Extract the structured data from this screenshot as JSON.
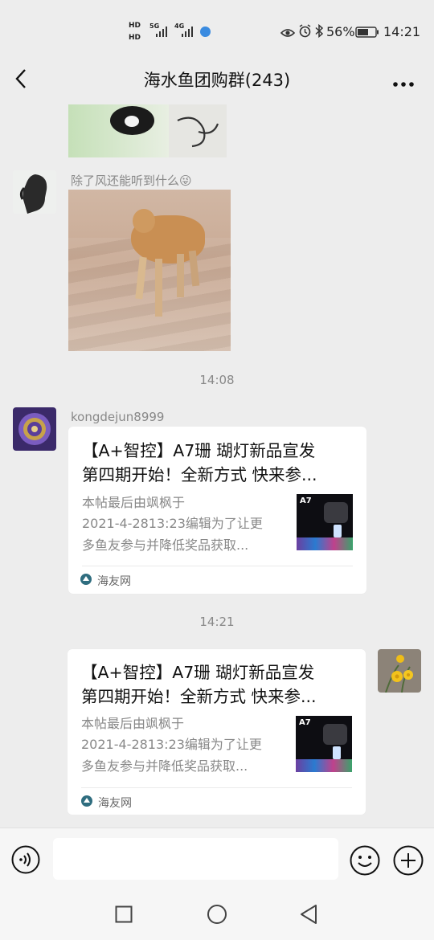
{
  "status_bar": {
    "hd1": "HD",
    "hd2": "HD",
    "net1": "5G",
    "net2": "4G",
    "battery_pct": "56%",
    "time": "14:21"
  },
  "header": {
    "back_icon": "chevron-left-icon",
    "title": "海水鱼团购群(243)",
    "more_icon": "more-dots-icon"
  },
  "messages": {
    "caption": "除了风还能听到什么",
    "caption_emoji": "😜",
    "time1": "14:08",
    "sender": "kongdejun8999",
    "time2": "14:21",
    "card1": {
      "title1": "【A+智控】A7珊 瑚灯新品宣发",
      "title2": "第四期开始！全新方式  快来参...",
      "desc1": "本帖最后由飒枫于",
      "desc2": "2021-4-2813:23编辑为了让更",
      "desc3": "多鱼友参与并降低奖品获取...",
      "source": "海友网",
      "thumb_label": "A7"
    },
    "card2": {
      "title1": "【A+智控】A7珊 瑚灯新品宣发",
      "title2": "第四期开始！全新方式  快来参...",
      "desc1": "本帖最后由飒枫于",
      "desc2": "2021-4-2813:23编辑为了让更",
      "desc3": "多鱼友参与并降低奖品获取...",
      "source": "海友网",
      "thumb_label": "A7"
    }
  },
  "input_bar": {
    "voice_icon": "voice-icon",
    "text_value": "",
    "emoji_icon": "emoji-icon",
    "plus_icon": "plus-icon"
  },
  "system_nav": {
    "recent_icon": "square-icon",
    "home_icon": "circle-icon",
    "back_icon": "triangle-back-icon"
  },
  "colors": {
    "background": "#ededed",
    "card": "#ffffff",
    "meta_text": "#888888"
  }
}
